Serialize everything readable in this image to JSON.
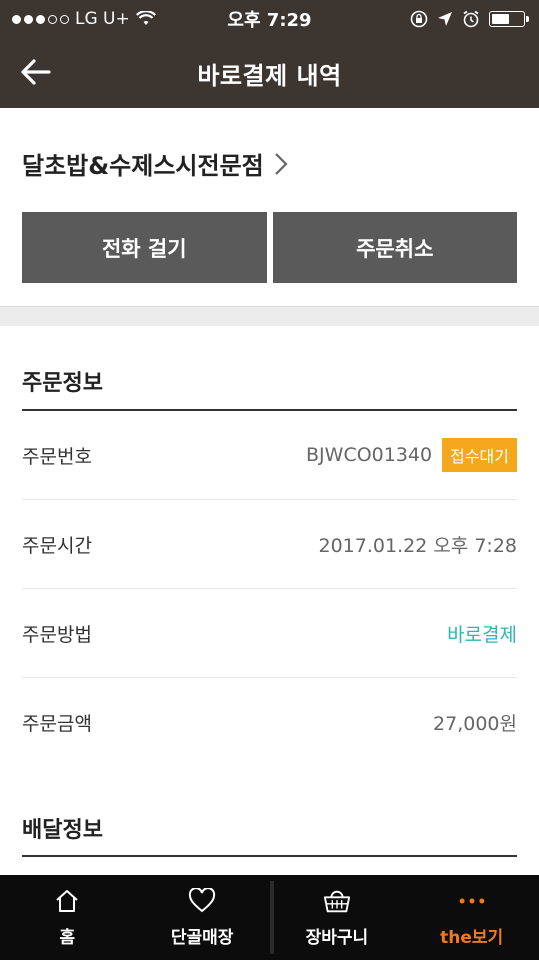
{
  "status_bar": {
    "carrier": "LG U+",
    "time": "오후 7:29",
    "battery_level": 0.55
  },
  "nav": {
    "title": "바로결제 내역"
  },
  "store": {
    "name": "달초밥&수제스시전문점",
    "call_button": "전화 걸기",
    "cancel_button": "주문취소"
  },
  "order_info": {
    "title": "주문정보",
    "rows": [
      {
        "label": "주문번호",
        "value": "BJWCO01340",
        "badge": "접수대기"
      },
      {
        "label": "주문시간",
        "value": "2017.01.22 오후 7:28"
      },
      {
        "label": "주문방법",
        "value": "바로결제"
      },
      {
        "label": "주문금액",
        "value": "27,000원"
      }
    ]
  },
  "delivery_info": {
    "title": "배달정보"
  },
  "tabbar": {
    "items": [
      {
        "label": "홈",
        "icon": "home-icon"
      },
      {
        "label": "단골매장",
        "icon": "heart-icon"
      },
      {
        "label": "장바구니",
        "icon": "basket-icon"
      },
      {
        "label": "the보기",
        "icon": "more-dots-icon",
        "active": true
      }
    ]
  },
  "colors": {
    "topbar": "#3d3530",
    "button": "#5a5a5a",
    "badge": "#f6a81c",
    "accent_text": "#2db7b2",
    "active_tab": "#f07a1a"
  }
}
